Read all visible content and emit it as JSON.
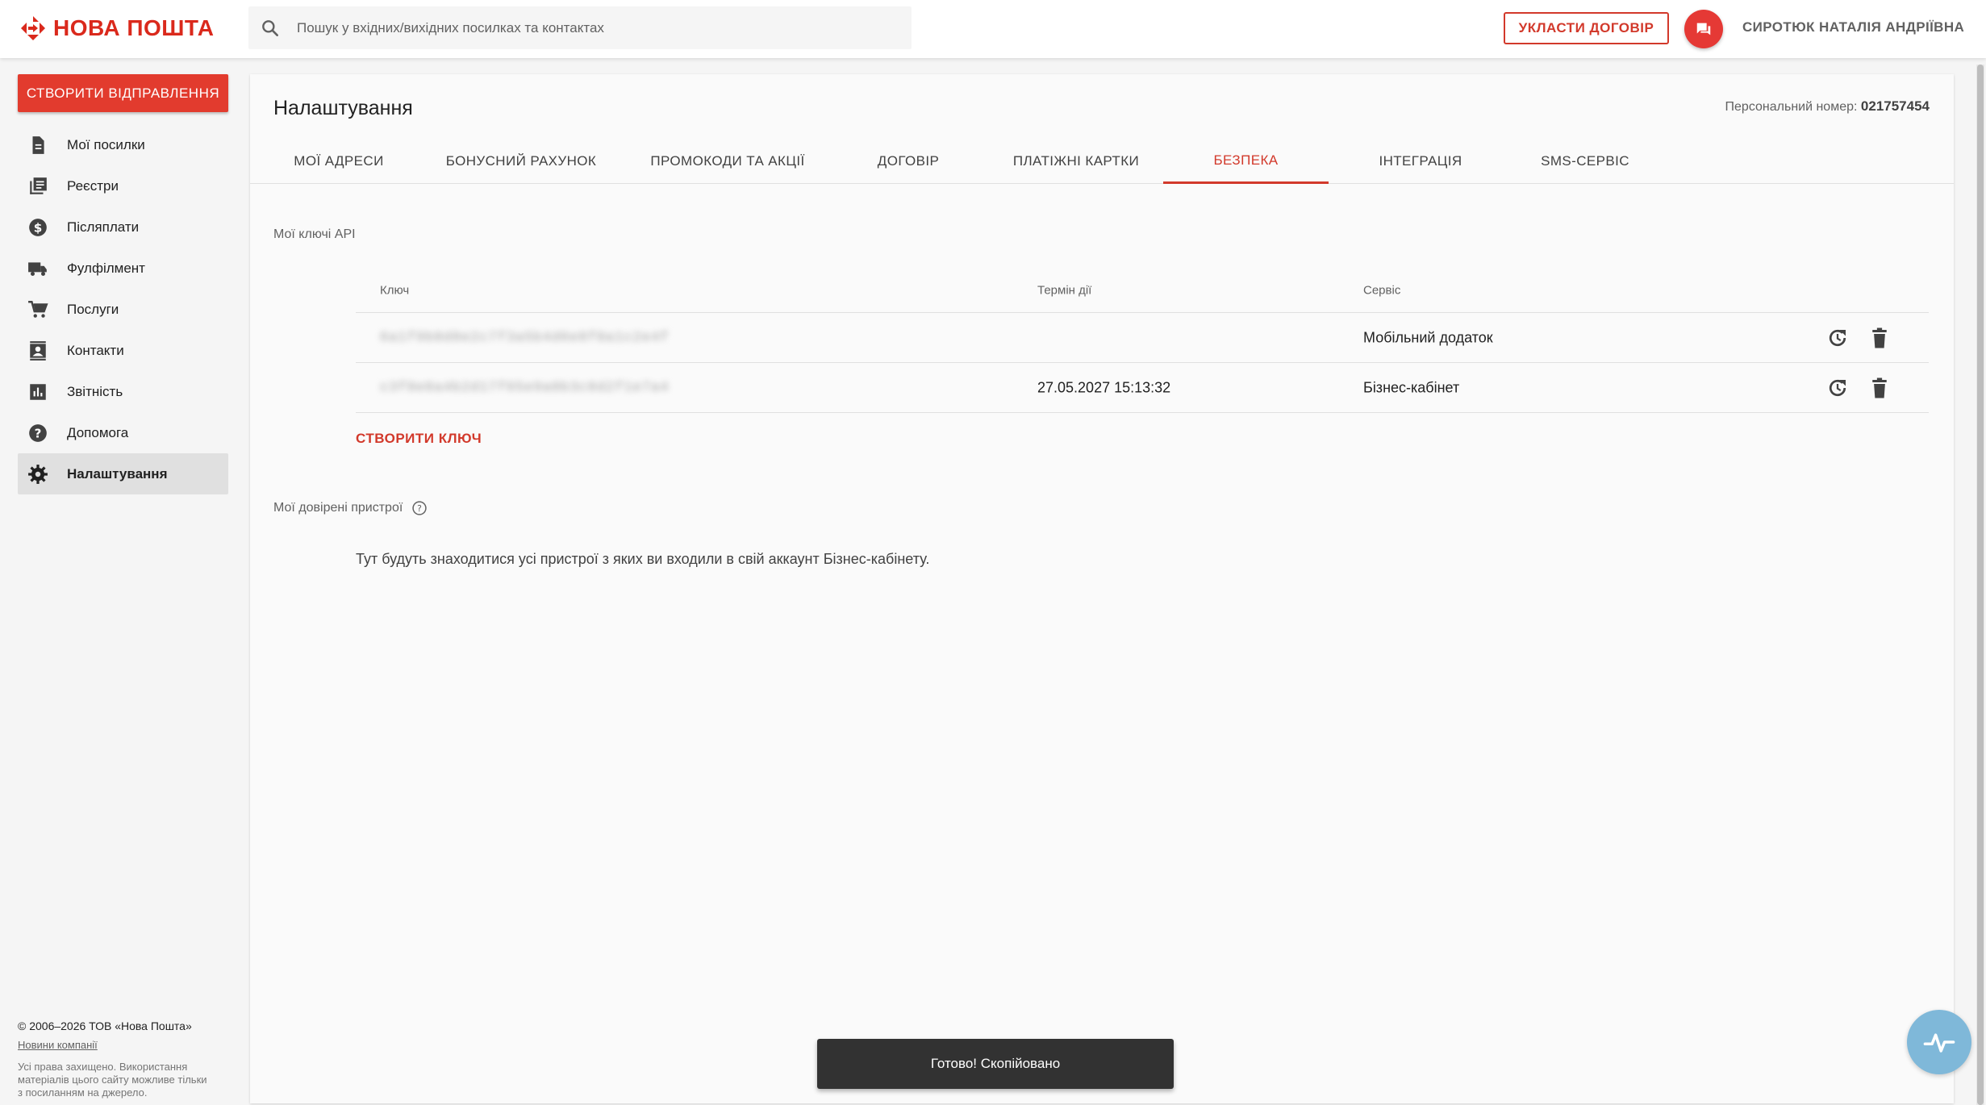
{
  "colors": {
    "brand": "#da291c",
    "accent": "#d2392b",
    "sidebar_active": "#e0e0e0",
    "snackbar": "#323232"
  },
  "header": {
    "logo_text": "НОВА ПОШТА",
    "logo_icon": "nova-poshta-logo-icon",
    "search_placeholder": "Пошук у вхідних/вихідних посилках та контактах",
    "contract_button": "УКЛАСТИ ДОГОВІР",
    "chat_icon": "chat-icon",
    "user_name": "СИРОТЮК НАТАЛІЯ АНДРІЇВНА"
  },
  "sidebar": {
    "create_button": "СТВОРИТИ ВІДПРАВЛЕННЯ",
    "items": [
      {
        "label": "Мої посилки",
        "icon": "document-icon",
        "active": false
      },
      {
        "label": "Реєстри",
        "icon": "registry-icon",
        "active": false
      },
      {
        "label": "Післяплати",
        "icon": "dollar-icon",
        "active": false
      },
      {
        "label": "Фулфілмент",
        "icon": "truck-icon",
        "active": false
      },
      {
        "label": "Послуги",
        "icon": "cart-icon",
        "active": false
      },
      {
        "label": "Контакти",
        "icon": "contacts-icon",
        "active": false
      },
      {
        "label": "Звітність",
        "icon": "chart-icon",
        "active": false
      },
      {
        "label": "Допомога",
        "icon": "help-icon",
        "active": false
      },
      {
        "label": "Налаштування",
        "icon": "gear-icon",
        "active": true
      }
    ],
    "footer": {
      "copyright": "© 2006–2026 ТОВ «Нова Пошта»",
      "news_link": "Новини компанії",
      "rights": "Усі права захищено. Використання матеріалів цього сайту можливе тільки з посиланням на джерело."
    }
  },
  "main": {
    "title": "Налаштування",
    "personal_label": "Персональний номер:",
    "personal_number": "021757454",
    "tabs": [
      {
        "label": "МОЇ АДРЕСИ",
        "active": false
      },
      {
        "label": "БОНУСНИЙ РАХУНОК",
        "active": false
      },
      {
        "label": "ПРОМОКОДИ ТА АКЦІЇ",
        "active": false
      },
      {
        "label": "ДОГОВІР",
        "active": false
      },
      {
        "label": "ПЛАТІЖНІ КАРТКИ",
        "active": false
      },
      {
        "label": "БЕЗПЕКА",
        "active": true
      },
      {
        "label": "ІНТЕГРАЦІЯ",
        "active": false
      },
      {
        "label": "SMS-СЕРВІС",
        "active": false
      }
    ],
    "api_keys": {
      "section_title": "Мої ключі API",
      "columns": {
        "key": "Ключ",
        "expiry": "Термін дії",
        "service": "Сервіс"
      },
      "rows": [
        {
          "key": "6a1f9b0d8e2c7f3a5b4d6e8f0a1c2e4f",
          "expiry": "",
          "service": "Мобільний додаток"
        },
        {
          "key": "c3f8e0a4b2d17f65e9a0b3c8d2f1e7a4",
          "expiry": "27.05.2027 15:13:32",
          "service": "Бізнес-кабінет"
        }
      ],
      "create_key": "СТВОРИТИ КЛЮЧ"
    },
    "devices": {
      "section_title": "Мої довірені пристрої",
      "text": "Тут будуть знаходитися усі пристрої з яких ви входили в свій аккаунт Бізнес-кабінету."
    }
  },
  "snackbar": {
    "text": "Готово! Скопійовано"
  }
}
